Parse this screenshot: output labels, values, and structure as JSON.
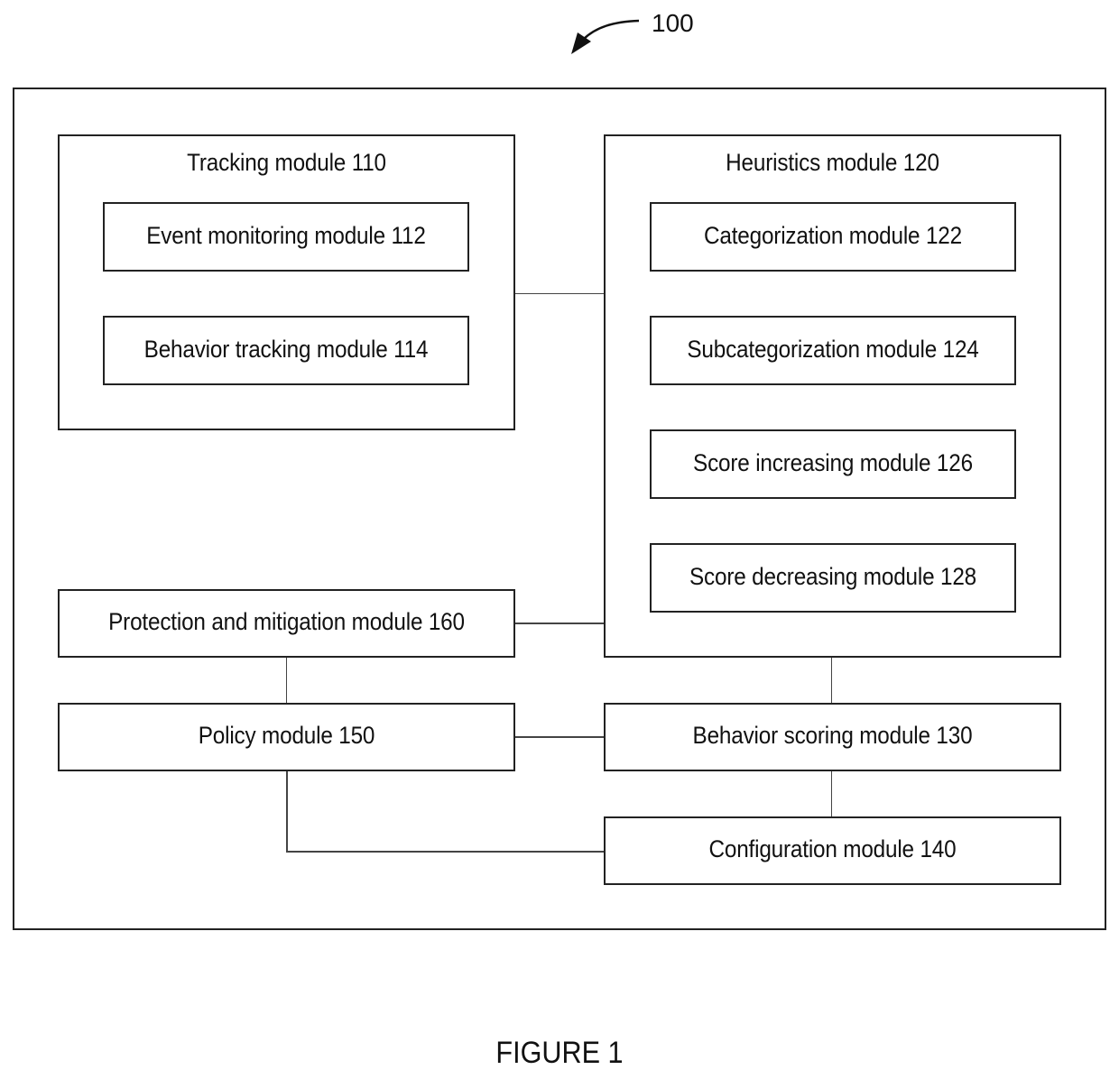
{
  "figure": {
    "reference": "100",
    "caption": "FIGURE 1"
  },
  "modules": {
    "tracking": {
      "label": "Tracking module 110"
    },
    "event_monitoring": {
      "label": "Event monitoring module 112"
    },
    "behavior_tracking": {
      "label": "Behavior tracking module 114"
    },
    "heuristics": {
      "label": "Heuristics module 120"
    },
    "categorization": {
      "label": "Categorization module 122"
    },
    "subcategorization": {
      "label": "Subcategorization module 124"
    },
    "score_increasing": {
      "label": "Score increasing module 126"
    },
    "score_decreasing": {
      "label": "Score decreasing module 128"
    },
    "protection": {
      "label": "Protection and mitigation module 160"
    },
    "policy": {
      "label": "Policy module 150"
    },
    "behavior_scoring": {
      "label": "Behavior scoring module 130"
    },
    "configuration": {
      "label": "Configuration module 140"
    }
  },
  "connections": [
    [
      "event_monitoring",
      "behavior_tracking"
    ],
    [
      "tracking",
      "heuristics"
    ],
    [
      "protection",
      "heuristics"
    ],
    [
      "protection",
      "policy"
    ],
    [
      "policy",
      "behavior_scoring"
    ],
    [
      "heuristics",
      "behavior_scoring"
    ],
    [
      "behavior_scoring",
      "configuration"
    ],
    [
      "policy",
      "configuration"
    ]
  ]
}
